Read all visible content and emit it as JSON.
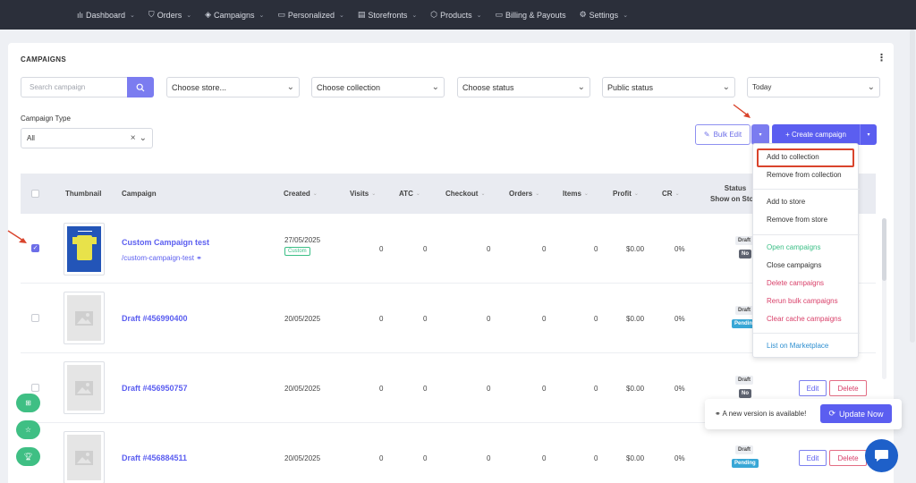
{
  "nav": {
    "items": [
      {
        "icon": "chart-icon",
        "glyph": "ılı",
        "label": "Dashboard",
        "chev": true
      },
      {
        "icon": "cart-icon",
        "glyph": "⛉",
        "label": "Orders",
        "chev": true
      },
      {
        "icon": "campaign-icon",
        "glyph": "◈",
        "label": "Campaigns",
        "chev": true
      },
      {
        "icon": "personalized-icon",
        "glyph": "▭",
        "label": "Personalized",
        "chev": true
      },
      {
        "icon": "storefront-icon",
        "glyph": "▤",
        "label": "Storefronts",
        "chev": true
      },
      {
        "icon": "products-icon",
        "glyph": "⬡",
        "label": "Products",
        "chev": true
      },
      {
        "icon": "billing-icon",
        "glyph": "▭",
        "label": "Billing & Payouts",
        "chev": false
      },
      {
        "icon": "settings-icon",
        "glyph": "⚙",
        "label": "Settings",
        "chev": true
      }
    ]
  },
  "page": {
    "title": "CAMPAIGNS",
    "kebab": "⋮"
  },
  "filters": {
    "search_placeholder": "Search campaign",
    "store": "Choose store...",
    "collection": "Choose collection",
    "status": "Choose status",
    "public_status": "Public status",
    "date": "Today",
    "campaign_type_label": "Campaign Type",
    "campaign_type_value": "All",
    "clear": "×",
    "chevron": "⌄"
  },
  "actions": {
    "bulk_edit": "Bulk Edit",
    "create_campaign": "+ Create campaign",
    "caret": "▾"
  },
  "table": {
    "headers": {
      "thumbnail": "Thumbnail",
      "campaign": "Campaign",
      "created": "Created",
      "visits": "Visits",
      "atc": "ATC",
      "checkout": "Checkout",
      "orders": "Orders",
      "items": "Items",
      "profit": "Profit",
      "cr": "CR",
      "status": "Status",
      "show_on_store": "Show on Store",
      "sort_glyph": "⌄"
    },
    "rows": [
      {
        "name": "Custom Campaign test",
        "slug": "/custom-campaign-test ⚭",
        "created": "27/05/2025",
        "tag": "Custom",
        "visits": "0",
        "atc": "0",
        "checkout": "0",
        "orders": "0",
        "items": "0",
        "profit": "$0.00",
        "cr": "0%",
        "status": "Draft",
        "store": "No",
        "checked": true
      },
      {
        "name": "Draft #456990400",
        "created": "20/05/2025",
        "visits": "0",
        "atc": "0",
        "checkout": "0",
        "orders": "0",
        "items": "0",
        "profit": "$0.00",
        "cr": "0%",
        "status": "Draft",
        "store": "Pending"
      },
      {
        "name": "Draft #456950757",
        "created": "20/05/2025",
        "visits": "0",
        "atc": "0",
        "checkout": "0",
        "orders": "0",
        "items": "0",
        "profit": "$0.00",
        "cr": "0%",
        "status": "Draft",
        "store": "No",
        "edit": "Edit",
        "delete": "Delete"
      },
      {
        "name": "Draft #456884511",
        "created": "20/05/2025",
        "visits": "0",
        "atc": "0",
        "checkout": "0",
        "orders": "0",
        "items": "0",
        "profit": "$0.00",
        "cr": "0%",
        "status": "Draft",
        "store": "Pending",
        "edit": "Edit",
        "delete": "Delete"
      }
    ]
  },
  "dropdown": {
    "items": [
      {
        "label": "Add to collection",
        "color": "#333333"
      },
      {
        "label": "Remove from collection",
        "color": "#333333"
      },
      {
        "label": "Add to store",
        "color": "#333333"
      },
      {
        "label": "Remove from store",
        "color": "#333333"
      },
      {
        "label": "Open campaigns",
        "color": "#3bbf86"
      },
      {
        "label": "Close campaigns",
        "color": "#333333"
      },
      {
        "label": "Delete campaigns",
        "color": "#d9416a"
      },
      {
        "label": "Rerun bulk campaigns",
        "color": "#d9416a"
      },
      {
        "label": "Clear cache campaigns",
        "color": "#d9416a"
      },
      {
        "label": "List on Marketplace",
        "color": "#2e8fd0"
      }
    ]
  },
  "notice": {
    "text": "⚭ A new version is available!",
    "button": "Update Now"
  },
  "colors": {
    "accent": "#5b5ef0",
    "nav_bg": "#2b2f3a",
    "success": "#3fbf84",
    "danger": "#d9416a",
    "annotation": "#d9442c"
  }
}
